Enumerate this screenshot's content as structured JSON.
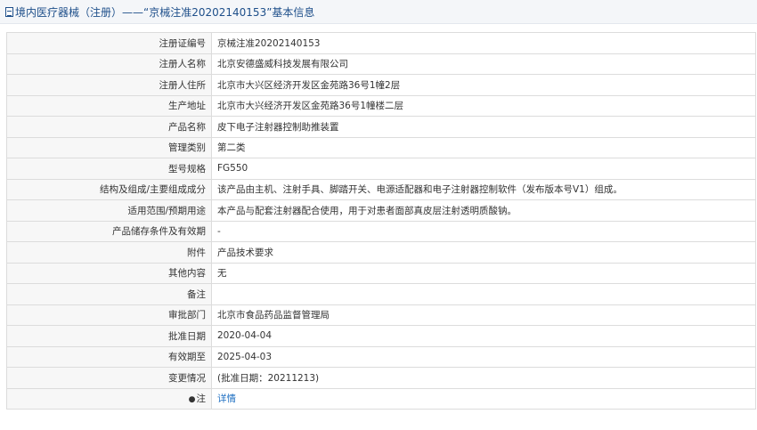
{
  "header": {
    "title": "境内医疗器械（注册）——“京械注准20202140153”基本信息"
  },
  "rows": [
    {
      "label": "注册证编号",
      "value": "京械注准20202140153"
    },
    {
      "label": "注册人名称",
      "value": "北京安德盛威科技发展有限公司"
    },
    {
      "label": "注册人住所",
      "value": "北京市大兴区经济开发区金苑路36号1幢2层"
    },
    {
      "label": "生产地址",
      "value": "北京市大兴经济开发区金苑路36号1幢楼二层"
    },
    {
      "label": "产品名称",
      "value": "皮下电子注射器控制助推装置"
    },
    {
      "label": "管理类别",
      "value": "第二类"
    },
    {
      "label": "型号规格",
      "value": "FG550"
    },
    {
      "label": "结构及组成/主要组成成分",
      "value": "该产品由主机、注射手具、脚踏开关、电源适配器和电子注射器控制软件（发布版本号V1）组成。"
    },
    {
      "label": "适用范围/预期用途",
      "value": "本产品与配套注射器配合使用，用于对患者面部真皮层注射透明质酸钠。"
    },
    {
      "label": "产品储存条件及有效期",
      "value": "-"
    },
    {
      "label": "附件",
      "value": "产品技术要求"
    },
    {
      "label": "其他内容",
      "value": "无"
    },
    {
      "label": "备注",
      "value": ""
    },
    {
      "label": "审批部门",
      "value": "北京市食品药品监督管理局"
    },
    {
      "label": "批准日期",
      "value": "2020-04-04"
    },
    {
      "label": "有效期至",
      "value": "2025-04-03"
    },
    {
      "label": "变更情况",
      "value": "(批准日期：20211213)"
    }
  ],
  "note": {
    "icon": "pin-icon",
    "label": "注",
    "link_text": "详情"
  }
}
